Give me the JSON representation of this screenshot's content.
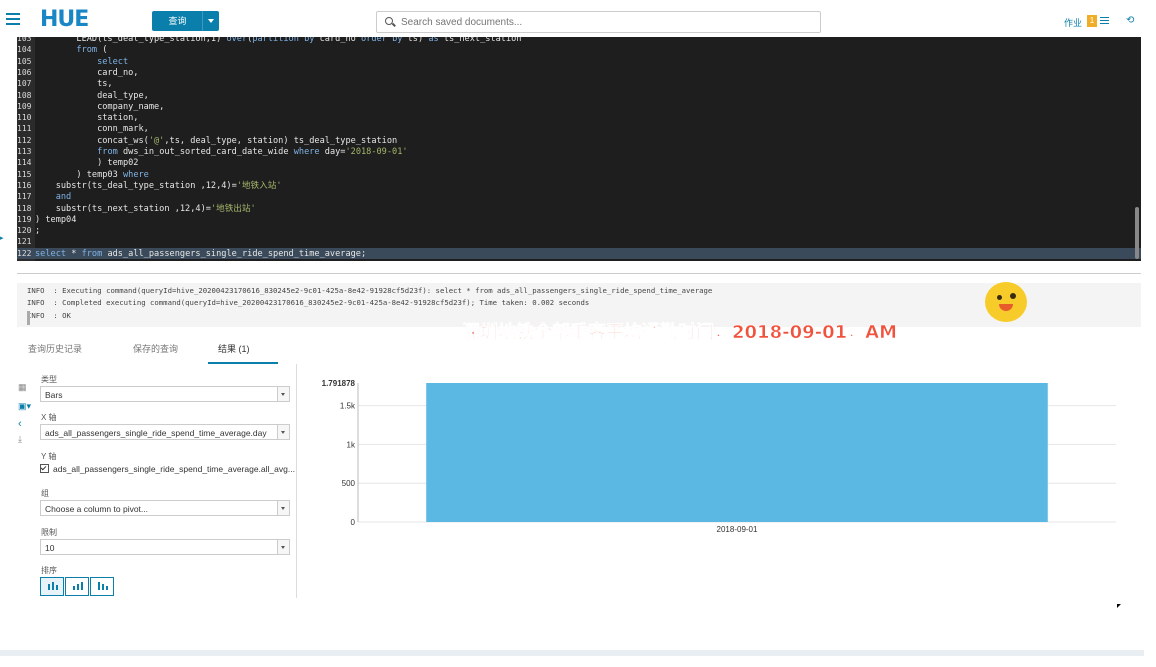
{
  "header": {
    "logo": "HUE",
    "query_button": "查询",
    "search_placeholder": "Search saved documents...",
    "jobs_label": "作业",
    "jobs_count": "1"
  },
  "editor": {
    "lines": [
      {
        "n": "103",
        "t": "        LEAD(ts_deal_type_station,1) over(partition by card_no order by ts) as ts_next_station"
      },
      {
        "n": "104",
        "t": "        from ("
      },
      {
        "n": "105",
        "t": "            select"
      },
      {
        "n": "106",
        "t": "            card_no,"
      },
      {
        "n": "107",
        "t": "            ts,"
      },
      {
        "n": "108",
        "t": "            deal_type,"
      },
      {
        "n": "109",
        "t": "            company_name,"
      },
      {
        "n": "110",
        "t": "            station,"
      },
      {
        "n": "111",
        "t": "            conn_mark,"
      },
      {
        "n": "112",
        "t": "            concat_ws('@',ts, deal_type, station) ts_deal_type_station"
      },
      {
        "n": "113",
        "t": "            from dws_in_out_sorted_card_date_wide where day='2018-09-01'"
      },
      {
        "n": "114",
        "t": "            ) temp02"
      },
      {
        "n": "115",
        "t": "        ) temp03 where"
      },
      {
        "n": "116",
        "t": "    substr(ts_deal_type_station ,12,4)='地铁入站'"
      },
      {
        "n": "117",
        "t": "    and"
      },
      {
        "n": "118",
        "t": "    substr(ts_next_station ,12,4)='地铁出站'"
      },
      {
        "n": "119",
        "t": ") temp04"
      },
      {
        "n": "120",
        "t": ";"
      },
      {
        "n": "121",
        "t": ""
      },
      {
        "n": "122",
        "t": "select * from ads_all_passengers_single_ride_spend_time_average;"
      }
    ]
  },
  "log": {
    "lines": [
      "INFO  : Executing command(queryId=hive_20200423170616_830245e2-9c01-425a-8e42-91928cf5d23f): select * from ads_all_passengers_single_ride_spend_time_average",
      "INFO  : Completed executing command(queryId=hive_20200423170616_830245e2-9c01-425a-8e42-91928cf5d23f); Time taken: 0.002 seconds",
      "INFO  : OK"
    ]
  },
  "overlay_caption": "深圳地铁全部乘客平均通勤时间，2018-09-01，AM",
  "tabs": [
    "查询历史记录",
    "保存的查询",
    "结果 (1)"
  ],
  "settings": {
    "type_label": "类型",
    "type_value": "Bars",
    "x_label": "X 轴",
    "x_value": "ads_all_passengers_single_ride_spend_time_average.day",
    "y_label": "Y 轴",
    "y_value": "ads_all_passengers_single_ride_spend_time_average.all_avg...",
    "group_label": "组",
    "group_value": "Choose a column to pivot...",
    "limit_label": "限制",
    "limit_value": "10",
    "sort_label": "排序"
  },
  "colors": {
    "accent": "#0b7fab",
    "bar": "#5bb8e3",
    "overlay": "#f0523c"
  },
  "chart_data": {
    "type": "bar",
    "categories": [
      "2018-09-01"
    ],
    "values": [
      1791.878
    ],
    "value_label": "1.791878",
    "ylim": [
      0,
      1791.878
    ],
    "yticks": [
      {
        "v": 0,
        "label": "0"
      },
      {
        "v": 500,
        "label": "500"
      },
      {
        "v": 1000,
        "label": "1k"
      },
      {
        "v": 1500,
        "label": "1.5k"
      }
    ],
    "grid": true
  }
}
